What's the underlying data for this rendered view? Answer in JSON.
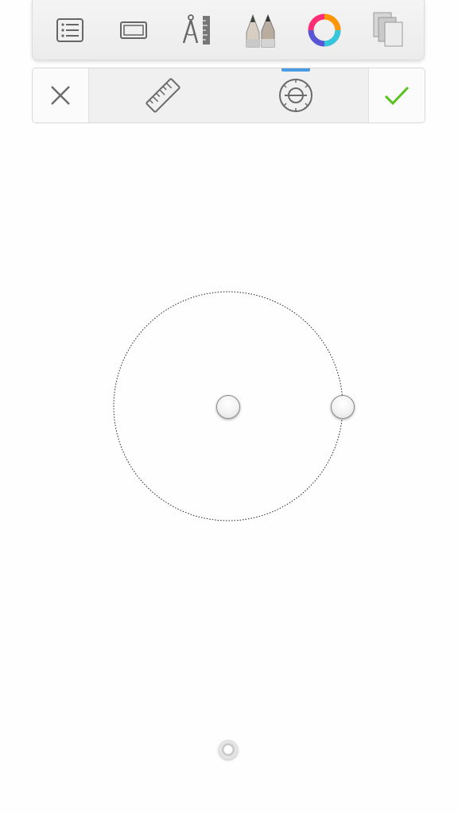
{
  "toolbar": {
    "tools": [
      {
        "name": "layers",
        "icon": "list-icon"
      },
      {
        "name": "canvas",
        "icon": "canvas-frame-icon"
      },
      {
        "name": "guides",
        "icon": "compass-ruler-icon"
      },
      {
        "name": "brushes",
        "icon": "brush-pencil-icon"
      },
      {
        "name": "color",
        "icon": "color-wheel-icon"
      },
      {
        "name": "copy",
        "icon": "copy-pages-icon"
      }
    ]
  },
  "guide_toolbar": {
    "cancel_icon": "close-icon",
    "accept_icon": "checkmark-icon",
    "tools": [
      {
        "name": "ruler",
        "icon": "ruler-icon",
        "active": false
      },
      {
        "name": "ellipse",
        "icon": "ellipse-guide-icon",
        "active": true
      }
    ],
    "accent_color": "#4a9be0",
    "accept_color": "#5ac21e"
  },
  "guide": {
    "type": "ellipse",
    "handles": [
      "center-handle",
      "radius-handle"
    ]
  },
  "puck": {
    "icon": "puck-icon"
  }
}
